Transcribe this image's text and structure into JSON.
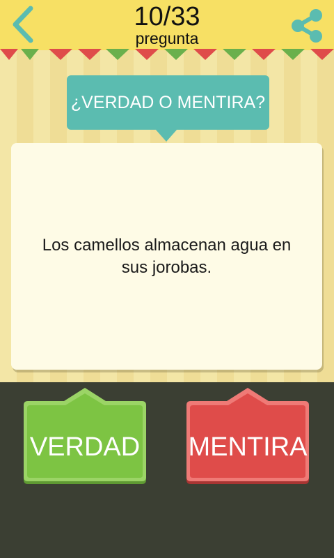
{
  "header": {
    "progress": "10/33",
    "progress_label": "pregunta",
    "back_icon": "chevron-left-icon",
    "share_icon": "share-icon"
  },
  "quiz": {
    "category": "¿VERDAD O MENTIRA?",
    "question": "Los camellos almacenan agua en sus jorobas."
  },
  "answers": {
    "true_label": "VERDAD",
    "false_label": "MENTIRA"
  },
  "colors": {
    "header": "#f7e064",
    "accent": "#5bbcb0",
    "true": "#7dc443",
    "false": "#df4c4a",
    "bottom": "#3b3f33"
  }
}
